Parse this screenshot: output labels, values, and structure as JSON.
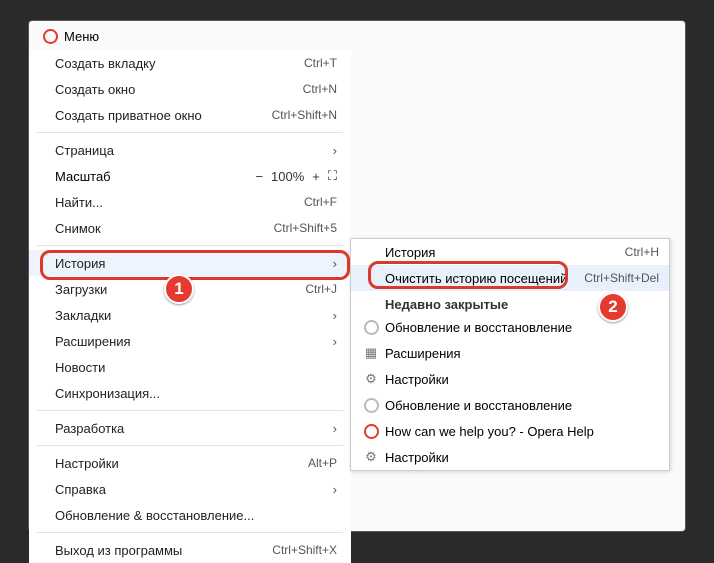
{
  "header": {
    "title": "Меню"
  },
  "main": {
    "new_tab": {
      "label": "Создать вкладку",
      "shortcut": "Ctrl+T"
    },
    "new_window": {
      "label": "Создать окно",
      "shortcut": "Ctrl+N"
    },
    "new_private": {
      "label": "Создать приватное окно",
      "shortcut": "Ctrl+Shift+N"
    },
    "page": {
      "label": "Страница"
    },
    "zoom": {
      "label": "Масштаб",
      "minus": "−",
      "value": "100%",
      "plus": "+",
      "full": "⛶"
    },
    "find": {
      "label": "Найти...",
      "shortcut": "Ctrl+F"
    },
    "snapshot": {
      "label": "Снимок",
      "shortcut": "Ctrl+Shift+5"
    },
    "history": {
      "label": "История"
    },
    "downloads": {
      "label": "Загрузки",
      "shortcut": "Ctrl+J"
    },
    "bookmarks": {
      "label": "Закладки"
    },
    "extensions": {
      "label": "Расширения"
    },
    "news": {
      "label": "Новости"
    },
    "sync": {
      "label": "Синхронизация..."
    },
    "developer": {
      "label": "Разработка"
    },
    "settings": {
      "label": "Настройки",
      "shortcut": "Alt+P"
    },
    "help": {
      "label": "Справка"
    },
    "update": {
      "label": "Обновление & восстановление..."
    },
    "exit": {
      "label": "Выход из программы",
      "shortcut": "Ctrl+Shift+X"
    }
  },
  "submenu": {
    "history": {
      "label": "История",
      "shortcut": "Ctrl+H"
    },
    "clear": {
      "label": "Очистить историю посещений",
      "shortcut": "Ctrl+Shift+Del"
    },
    "recently_closed": {
      "label": "Недавно закрытые"
    },
    "update_restore": {
      "label": "Обновление и восстановление"
    },
    "extensions": {
      "label": "Расширения"
    },
    "settings1": {
      "label": "Настройки"
    },
    "update_restore2": {
      "label": "Обновление и восстановление"
    },
    "opera_help": {
      "label": "How can we help you? - Opera Help"
    },
    "settings2": {
      "label": "Настройки"
    }
  },
  "badges": {
    "one": "1",
    "two": "2"
  }
}
